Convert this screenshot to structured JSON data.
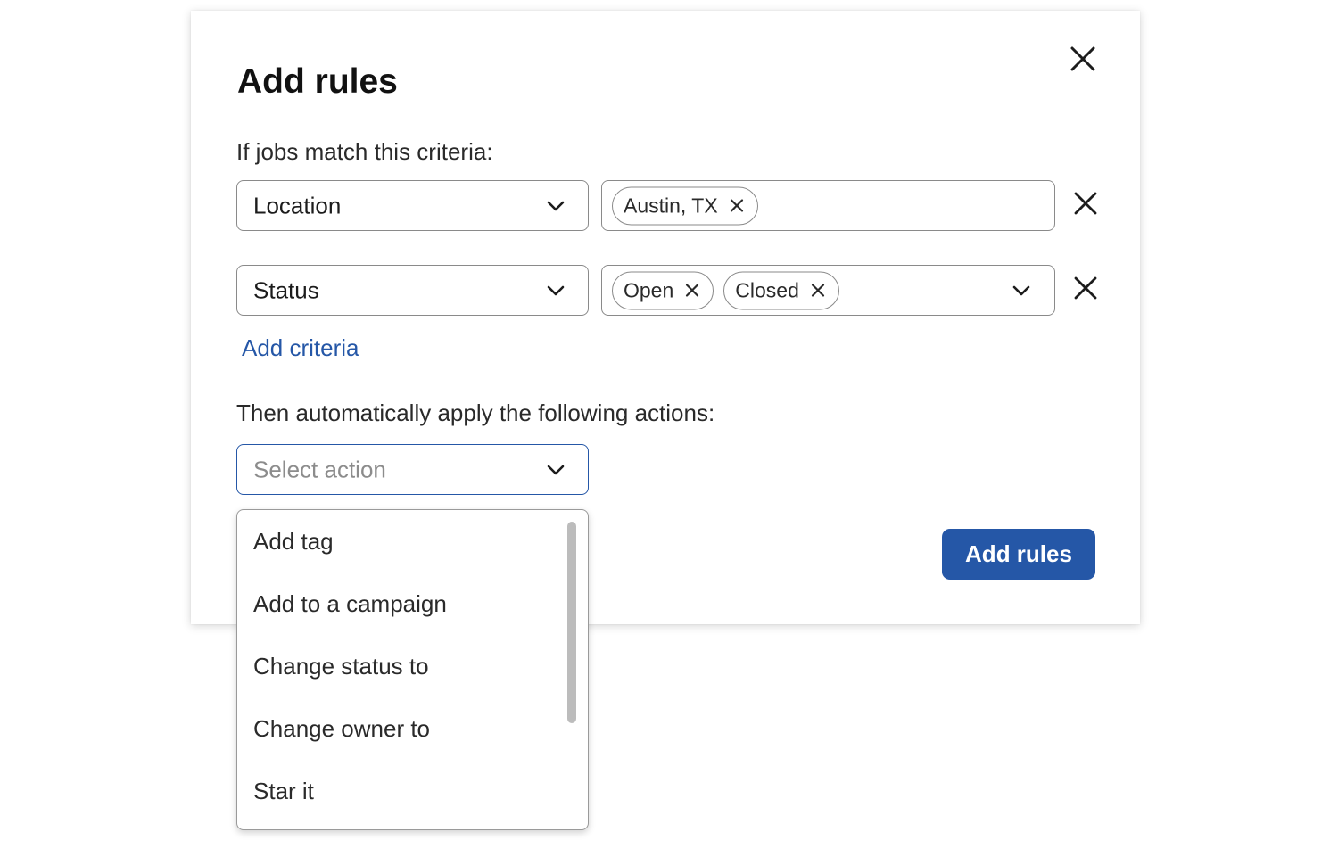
{
  "modal": {
    "title": "Add rules",
    "criteria_label": "If jobs match this criteria:",
    "criteria": [
      {
        "field": "Location",
        "chips": [
          "Austin, TX"
        ],
        "has_dropdown": false
      },
      {
        "field": "Status",
        "chips": [
          "Open",
          "Closed"
        ],
        "has_dropdown": true
      }
    ],
    "add_criteria_label": "Add criteria",
    "actions_label": "Then automatically apply the following actions:",
    "action_select": {
      "placeholder": "Select action",
      "options": [
        "Add tag",
        "Add to a campaign",
        "Change status to",
        "Change owner to",
        "Star it"
      ]
    },
    "submit_label": "Add rules"
  },
  "icons": {
    "close": "close-icon",
    "chevron": "chevron-down-icon",
    "chip_remove": "x-icon"
  },
  "colors": {
    "accent": "#2557a7",
    "border": "#8a8a8a",
    "placeholder": "#8c8c8c"
  }
}
